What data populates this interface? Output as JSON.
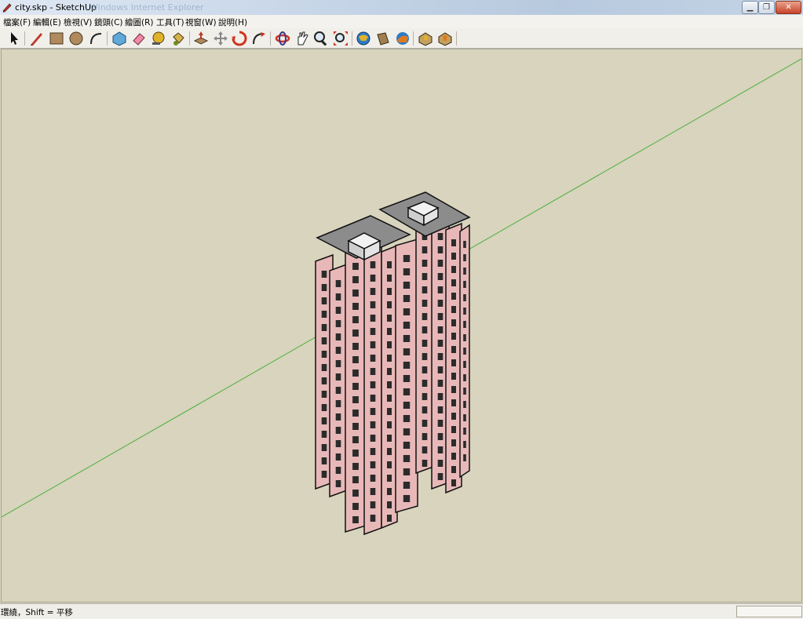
{
  "window": {
    "title": "city.skp - SketchUp",
    "title_overlay": "Windows Internet Explorer",
    "minimize_icon": "minimize-icon",
    "maximize_icon": "restore-icon",
    "close_icon": "close-icon"
  },
  "menu": {
    "items": [
      {
        "label": "檔案(F)"
      },
      {
        "label": "編輯(E)"
      },
      {
        "label": "檢視(V)"
      },
      {
        "label": "鏡頭(C)"
      },
      {
        "label": "繪圖(R)"
      },
      {
        "label": "工具(T)"
      },
      {
        "label": "視窗(W)"
      },
      {
        "label": "說明(H)"
      }
    ]
  },
  "toolbar": {
    "tools": [
      {
        "name": "select-icon"
      },
      {
        "name": "pencil-line-icon"
      },
      {
        "name": "rectangle-icon"
      },
      {
        "name": "circle-icon"
      },
      {
        "name": "arc-icon"
      },
      {
        "name": "make-component-icon"
      },
      {
        "name": "eraser-icon"
      },
      {
        "name": "tape-measure-icon"
      },
      {
        "name": "paint-bucket-icon"
      },
      {
        "name": "push-pull-icon"
      },
      {
        "name": "move-icon"
      },
      {
        "name": "rotate-icon"
      },
      {
        "name": "follow-me-icon"
      },
      {
        "name": "orbit-icon"
      },
      {
        "name": "pan-icon"
      },
      {
        "name": "zoom-icon"
      },
      {
        "name": "zoom-extents-icon"
      },
      {
        "name": "get-models-icon"
      },
      {
        "name": "share-model-icon"
      },
      {
        "name": "google-earth-icon"
      },
      {
        "name": "component-browser-icon"
      },
      {
        "name": "share-component-icon"
      }
    ]
  },
  "status": {
    "message": "環繞，Shift = 平移"
  },
  "colors": {
    "canvas": "#d8d4bd",
    "building_facade": "#e8b8b8",
    "roof": "#8c8c8c",
    "green_axis": "#4caf3c"
  }
}
